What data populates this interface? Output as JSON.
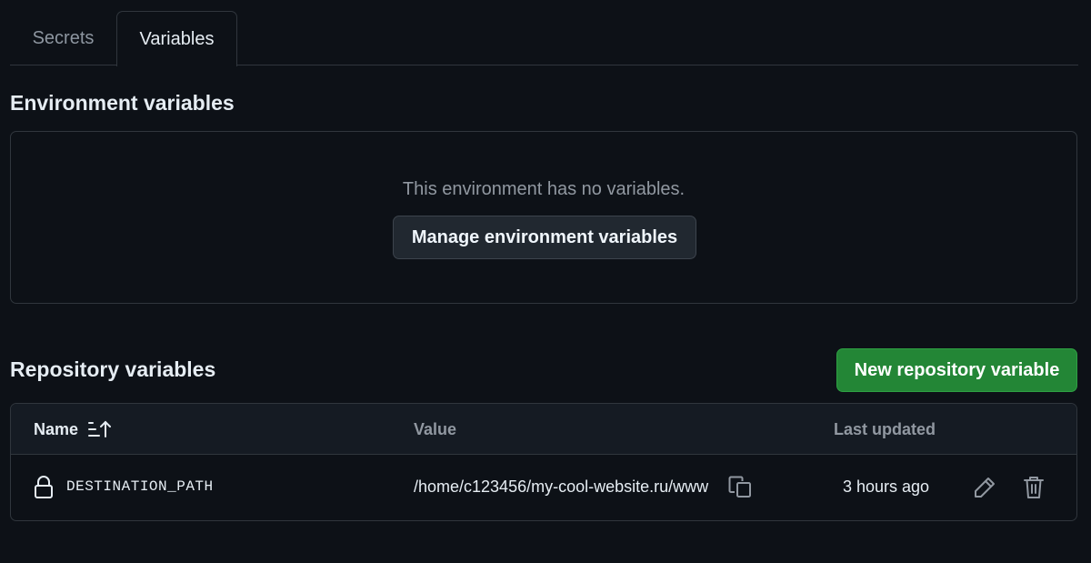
{
  "tabs": [
    {
      "label": "Secrets",
      "active": false
    },
    {
      "label": "Variables",
      "active": true
    }
  ],
  "environment": {
    "title": "Environment variables",
    "empty_message": "This environment has no variables.",
    "manage_button": "Manage environment variables"
  },
  "repository": {
    "title": "Repository variables",
    "new_button": "New repository variable",
    "columns": {
      "name": "Name",
      "value": "Value",
      "last_updated": "Last updated"
    },
    "rows": [
      {
        "name": "DESTINATION_PATH",
        "value": "/home/c123456/my-cool-website.ru/www",
        "last_updated": "3 hours ago"
      }
    ]
  },
  "colors": {
    "background": "#0d1117",
    "border": "#30363d",
    "primary_button": "#238636",
    "muted_text": "#9198a1"
  },
  "icons": [
    "sort-ascending-icon",
    "lock-icon",
    "copy-icon",
    "pencil-icon",
    "trash-icon"
  ]
}
